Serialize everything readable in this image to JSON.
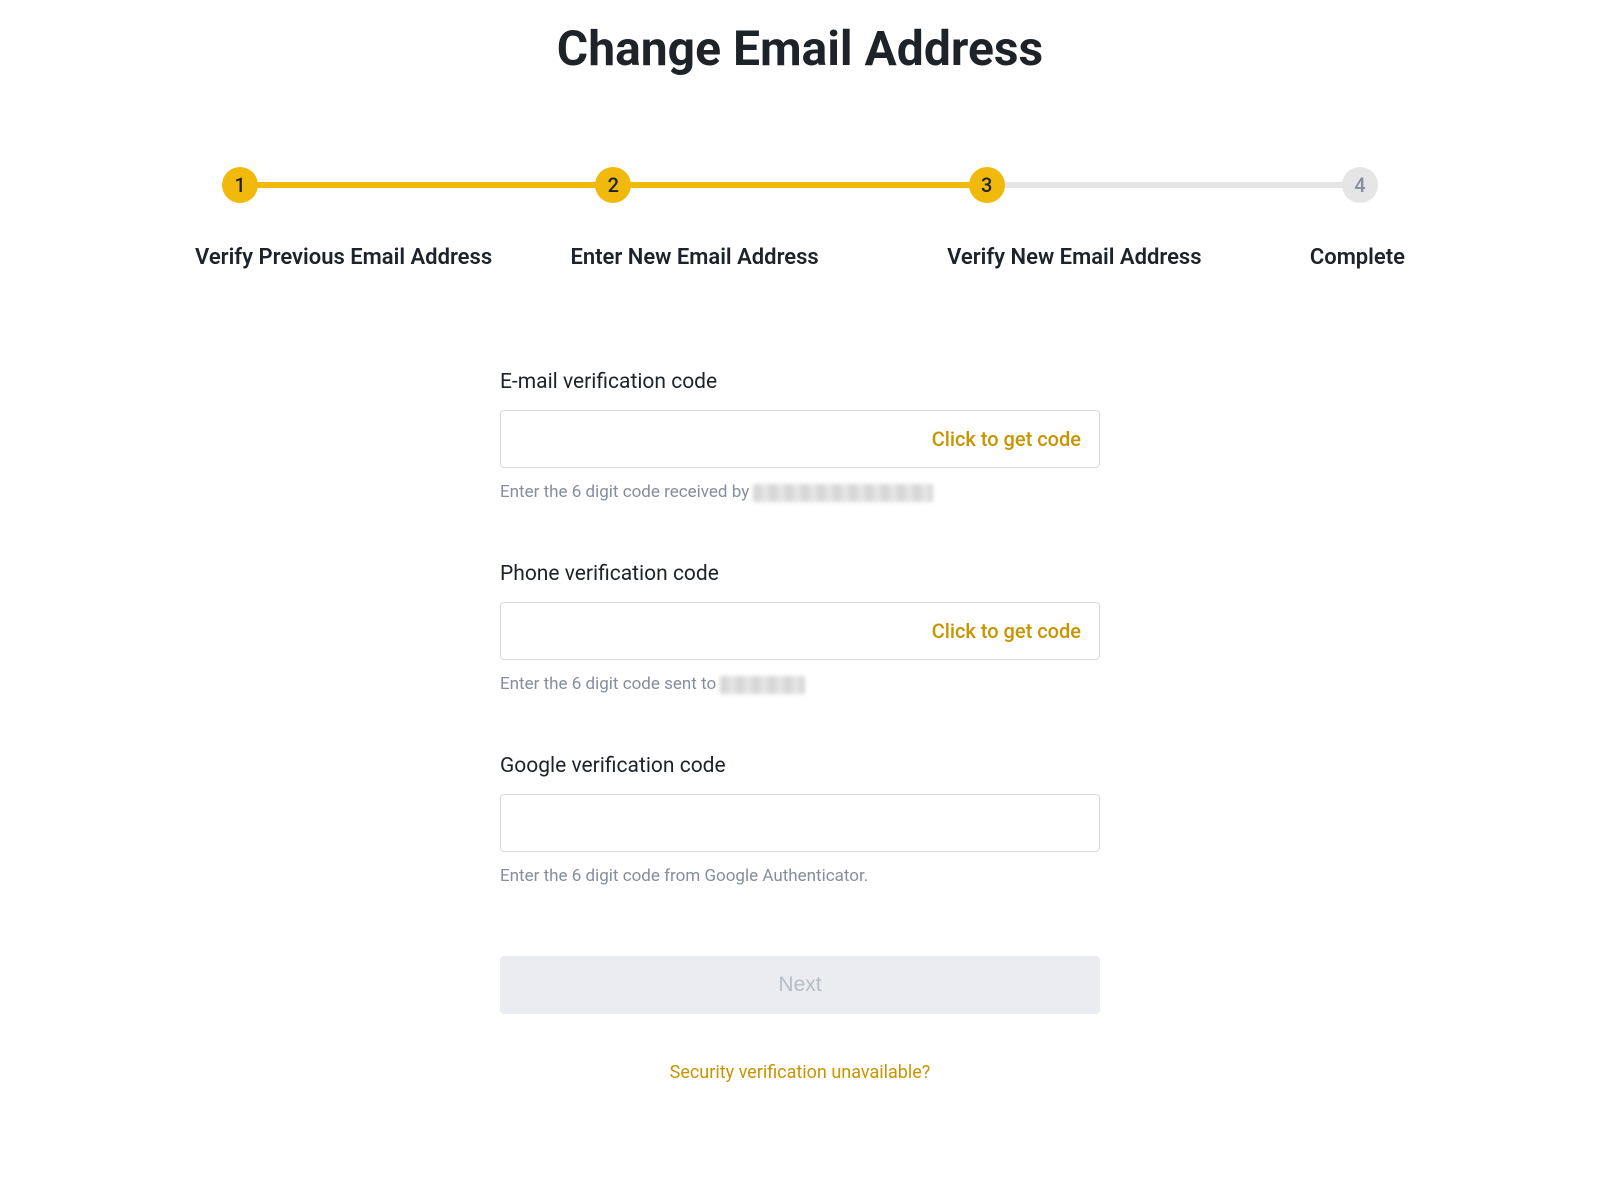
{
  "title": "Change Email Address",
  "stepper": {
    "current": 3,
    "steps": [
      {
        "num": "1",
        "label": "Verify Previous Email Address",
        "active": true
      },
      {
        "num": "2",
        "label": "Enter New Email Address",
        "active": true
      },
      {
        "num": "3",
        "label": "Verify New Email Address",
        "active": true
      },
      {
        "num": "4",
        "label": "Complete",
        "active": false
      }
    ]
  },
  "form": {
    "email": {
      "label": "E-mail verification code",
      "action": "Click to get code",
      "helper_prefix": "Enter the 6 digit code received by "
    },
    "phone": {
      "label": "Phone verification code",
      "action": "Click to get code",
      "helper_prefix": "Enter the 6 digit code sent to "
    },
    "google": {
      "label": "Google verification code",
      "helper": "Enter the 6 digit code from Google Authenticator."
    },
    "next_label": "Next",
    "security_link": "Security verification unavailable?"
  }
}
